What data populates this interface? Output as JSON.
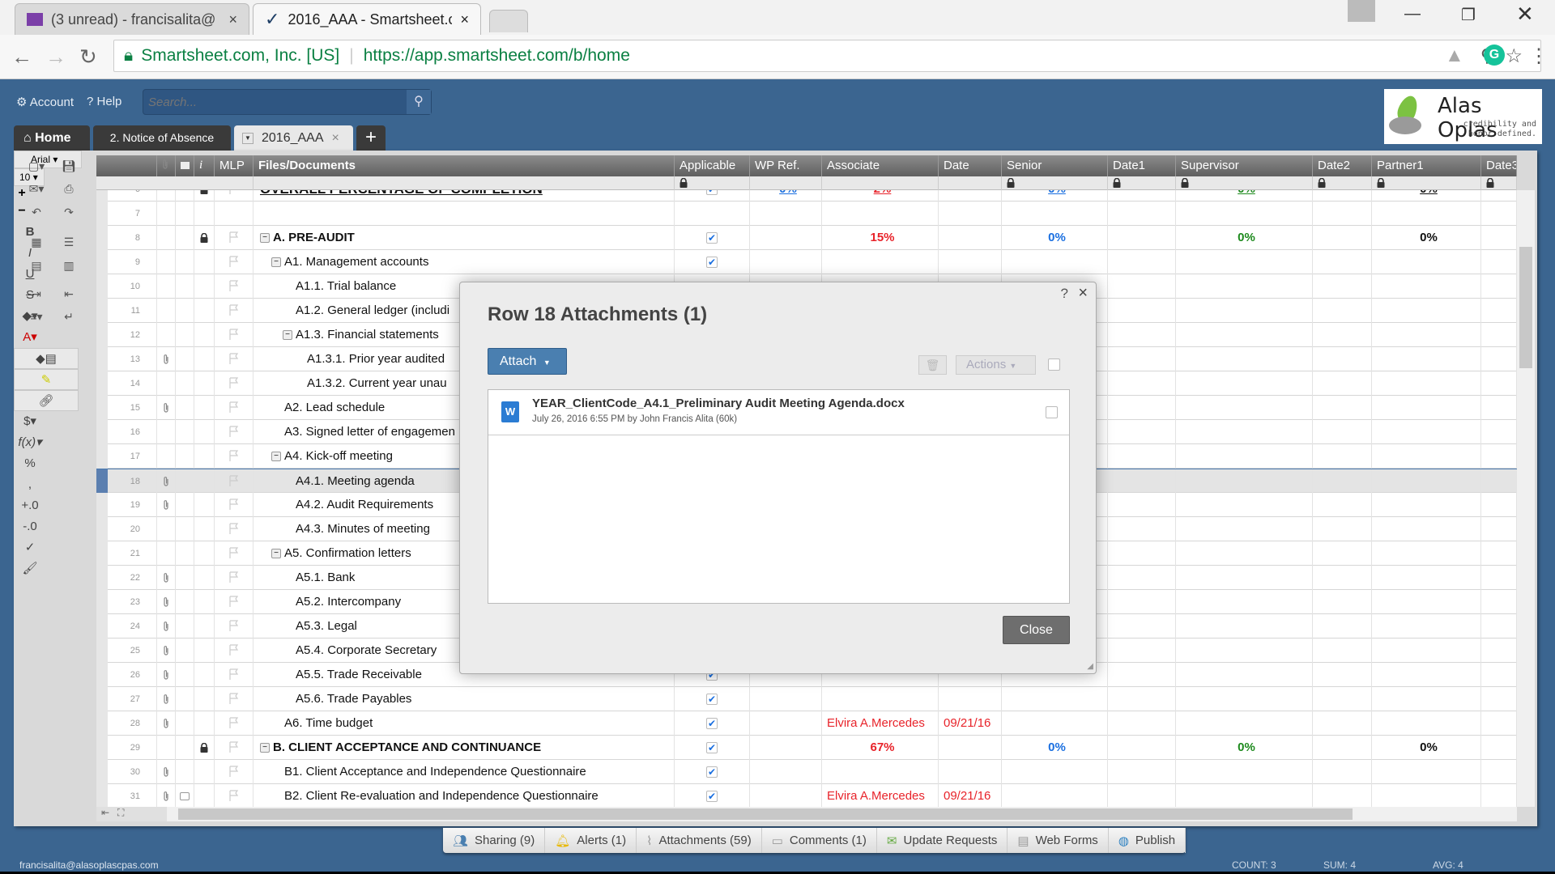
{
  "browser": {
    "tabs": [
      {
        "title": "(3 unread) - francisalita@",
        "icon": "mail-icon",
        "active": false
      },
      {
        "title": "2016_AAA - Smartsheet.c",
        "icon": "smartsheet-check-icon",
        "active": true
      }
    ],
    "secure_label": "Smartsheet.com, Inc. [US]",
    "url": "https://app.smartsheet.com/b/home"
  },
  "topbar": {
    "account_label": "Account",
    "help_label": "Help",
    "search_placeholder": "Search...",
    "logo": {
      "name": "Alas Oplas",
      "tagline": "credibility and honor defined."
    }
  },
  "sheet_tabs": [
    {
      "label": "Home",
      "icon": "home-icon"
    },
    {
      "label": "2. Notice of Absence"
    },
    {
      "label": "2016_AAA",
      "active": true
    }
  ],
  "toolbar": {
    "font": "Arial",
    "font_size": "10"
  },
  "columns": [
    "MLP",
    "Files/Documents",
    "Applicable",
    "WP Ref.",
    "Associate",
    "Date",
    "Senior",
    "Date1",
    "Supervisor",
    "Date2",
    "Partner1",
    "Date3"
  ],
  "colors": {
    "red": "#e8232a",
    "blue": "#1a6fe0",
    "green": "#1d8a1d",
    "brand_blue": "#3b6590"
  },
  "rows": [
    {
      "n": "6",
      "text": "OVERALL PERCENTAGE OF COMPLETION",
      "level": 0,
      "bold": true,
      "underline": true,
      "lockicon": true,
      "wp": "0%",
      "associate": "2%",
      "senior": "0%",
      "supervisor": "0%",
      "partner": "0%",
      "check": true
    },
    {
      "n": "7",
      "text": "",
      "level": 0,
      "noflag": true
    },
    {
      "n": "8",
      "text": "A. PRE-AUDIT",
      "level": 0,
      "bold": true,
      "collapse": true,
      "lockicon": true,
      "check": true,
      "associate": "15%",
      "senior": "0%",
      "supervisor": "0%",
      "partner": "0%"
    },
    {
      "n": "9",
      "text": "A1. Management accounts",
      "level": 1,
      "collapse": true,
      "check": true
    },
    {
      "n": "10",
      "text": "A1.1. Trial balance",
      "level": 2
    },
    {
      "n": "11",
      "text": "A1.2. General ledger (includi",
      "level": 2
    },
    {
      "n": "12",
      "text": "A1.3. Financial statements",
      "level": 2,
      "collapse": true
    },
    {
      "n": "13",
      "text": "A1.3.1. Prior year audited",
      "level": 3,
      "attach": true
    },
    {
      "n": "14",
      "text": "A1.3.2. Current year unau",
      "level": 3
    },
    {
      "n": "15",
      "text": "A2. Lead schedule",
      "level": 1,
      "attach": true
    },
    {
      "n": "16",
      "text": "A3. Signed letter of engagemen",
      "level": 1
    },
    {
      "n": "17",
      "text": "A4. Kick-off meeting",
      "level": 1,
      "collapse": true
    },
    {
      "n": "18",
      "text": "A4.1. Meeting agenda",
      "level": 2,
      "attach": true,
      "selected": true
    },
    {
      "n": "19",
      "text": "A4.2. Audit Requirements",
      "level": 2,
      "attach": true
    },
    {
      "n": "20",
      "text": "A4.3. Minutes of meeting",
      "level": 2
    },
    {
      "n": "21",
      "text": "A5. Confirmation letters",
      "level": 1,
      "collapse": true
    },
    {
      "n": "22",
      "text": "A5.1. Bank",
      "level": 2,
      "attach": true
    },
    {
      "n": "23",
      "text": "A5.2. Intercompany",
      "level": 2,
      "attach": true
    },
    {
      "n": "24",
      "text": "A5.3. Legal",
      "level": 2,
      "attach": true
    },
    {
      "n": "25",
      "text": "A5.4. Corporate Secretary",
      "level": 2,
      "attach": true
    },
    {
      "n": "26",
      "text": "A5.5. Trade Receivable",
      "level": 2,
      "attach": true,
      "check": true
    },
    {
      "n": "27",
      "text": "A5.6. Trade Payables",
      "level": 2,
      "attach": true,
      "check": true
    },
    {
      "n": "28",
      "text": "A6. Time budget",
      "level": 1,
      "attach": true,
      "check": true,
      "associate": "Elvira A.Mercedes",
      "date": "09/21/16"
    },
    {
      "n": "29",
      "text": "B. CLIENT ACCEPTANCE AND CONTINUANCE",
      "level": 0,
      "bold": true,
      "collapse": true,
      "lockicon": true,
      "check": true,
      "associate": "67%",
      "senior": "0%",
      "supervisor": "0%",
      "partner": "0%"
    },
    {
      "n": "30",
      "text": "B1. Client Acceptance and Independence Questionnaire",
      "level": 1,
      "attach": true,
      "check": true
    },
    {
      "n": "31",
      "text": "B2. Client Re-evaluation and Independence Questionnaire",
      "level": 1,
      "attach": true,
      "comment": true,
      "check": true,
      "associate": "Elvira A.Mercedes",
      "date": "09/21/16"
    }
  ],
  "dialog": {
    "title": "Row 18 Attachments (1)",
    "help": "?",
    "attach_label": "Attach",
    "actions_label": "Actions",
    "file": {
      "name": "YEAR_ClientCode_A4.1_Preliminary Audit Meeting Agenda.docx",
      "meta": "July 26, 2016 6:55 PM by John Francis Alita (60k)",
      "icon": "word-doc-icon"
    },
    "close_label": "Close"
  },
  "bottom_tabs": [
    {
      "label": "Sharing (9)",
      "icon": "sharing-icon"
    },
    {
      "label": "Alerts (1)",
      "icon": "bell-icon"
    },
    {
      "label": "Attachments (59)",
      "icon": "paperclip-icon"
    },
    {
      "label": "Comments (1)",
      "icon": "comment-icon"
    },
    {
      "label": "Update Requests",
      "icon": "update-request-icon"
    },
    {
      "label": "Web Forms",
      "icon": "form-icon"
    },
    {
      "label": "Publish",
      "icon": "globe-icon"
    }
  ],
  "status": {
    "user": "francisalita@alasoplascpas.com",
    "count": "COUNT: 3",
    "sum": "SUM: 4",
    "avg": "AVG: 4"
  }
}
